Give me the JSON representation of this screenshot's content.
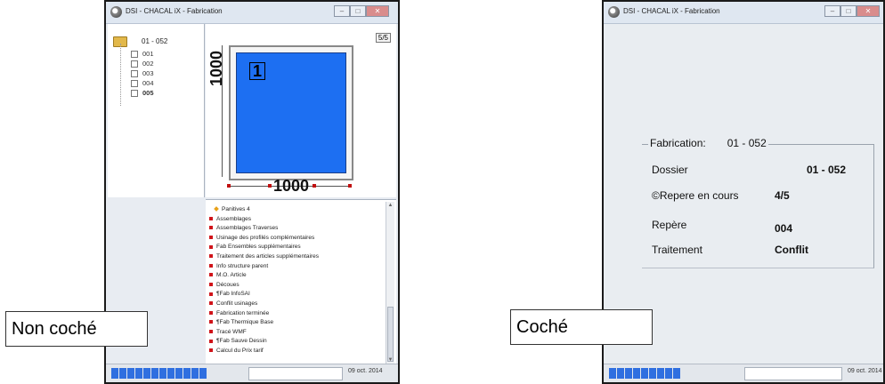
{
  "left_window": {
    "title": "DSI - CHACAL iX - Fabrication",
    "tree": {
      "root_label": "01 - 052",
      "items": [
        "001",
        "002",
        "003",
        "004",
        "005"
      ]
    },
    "drawing": {
      "page_indicator": "5/5",
      "pane_number": "1",
      "height_dim": "1000",
      "width_dim": "1000"
    },
    "list": [
      "Panitives 4",
      "Assemblages",
      "Assemblages Traverses",
      "Usinage des profilés complémentaires",
      "Fab Ensembles supplémentaires",
      "Traitement des articles supplémentaires",
      "Info structure parent",
      "M.O. Article",
      "Découes",
      "¶Fab InfoSAI",
      "Conflit usinages",
      "Fabrication terminée",
      "¶Fab Thermique Base",
      "Tracé WMF",
      "¶Fab Sauve Dessin",
      "Calcul du Prix tarif"
    ],
    "status": {
      "date": "09 oct. 2014",
      "progress_segments": 12
    }
  },
  "right_window": {
    "title": "DSI - CHACAL iX - Fabrication",
    "group_legend": "Fabrication:",
    "group_legend_value": "01 - 052",
    "fields": {
      "dossier_label": "Dossier",
      "dossier_value": "01 - 052",
      "repere_cours_label": "©Repere en cours",
      "repere_cours_value": "4/5",
      "repere_label": "Repère",
      "repere_value": "004",
      "traitement_label": "Traitement",
      "traitement_value": "Conflit"
    },
    "status": {
      "date": "09 oct. 2014",
      "progress_segments": 9
    }
  },
  "captions": {
    "left": "Non coché",
    "right": "Coché"
  },
  "colors": {
    "glass": "#1d6ff2",
    "progress": "#2f6fe0",
    "bullet": "#d0141a"
  }
}
